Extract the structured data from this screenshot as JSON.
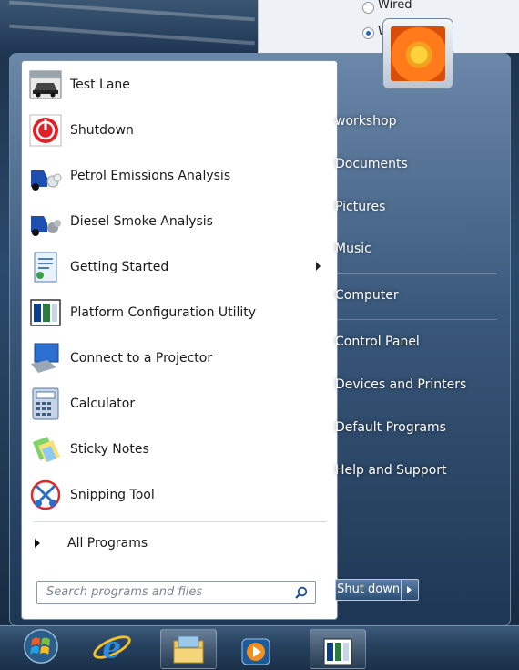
{
  "background_window": {
    "radio_options": [
      {
        "label": "Wired",
        "selected": false
      },
      {
        "label": "W",
        "selected": true
      }
    ]
  },
  "start_menu": {
    "programs": [
      {
        "label": "Test Lane",
        "icon": "car-icon",
        "has_submenu": false
      },
      {
        "label": "Shutdown",
        "icon": "power-icon",
        "has_submenu": false
      },
      {
        "label": "Petrol Emissions Analysis",
        "icon": "petrol-emissions-icon",
        "has_submenu": false
      },
      {
        "label": "Diesel Smoke Analysis",
        "icon": "diesel-smoke-icon",
        "has_submenu": false
      },
      {
        "label": "Getting Started",
        "icon": "getting-started-icon",
        "has_submenu": true
      },
      {
        "label": "Platform Configuration Utility",
        "icon": "platform-config-icon",
        "has_submenu": false
      },
      {
        "label": "Connect to a Projector",
        "icon": "projector-icon",
        "has_submenu": false
      },
      {
        "label": "Calculator",
        "icon": "calculator-icon",
        "has_submenu": false
      },
      {
        "label": "Sticky Notes",
        "icon": "sticky-notes-icon",
        "has_submenu": false
      },
      {
        "label": "Snipping Tool",
        "icon": "snipping-tool-icon",
        "has_submenu": false
      }
    ],
    "all_programs_label": "All Programs",
    "search_placeholder": "Search programs and files",
    "right_links": [
      "workshop",
      "Documents",
      "Pictures",
      "Music",
      "Computer",
      "Control Panel",
      "Devices and Printers",
      "Default Programs",
      "Help and Support"
    ],
    "shutdown_label": "Shut down",
    "annotation_arrow_color": "#e8101a"
  },
  "taskbar": {
    "items": [
      "start-orb-icon",
      "internet-explorer-icon",
      "file-explorer-icon",
      "media-player-icon",
      "platform-config-icon"
    ]
  },
  "colors": {
    "accent": "#2d4e74",
    "annotation": "#e8101a"
  }
}
